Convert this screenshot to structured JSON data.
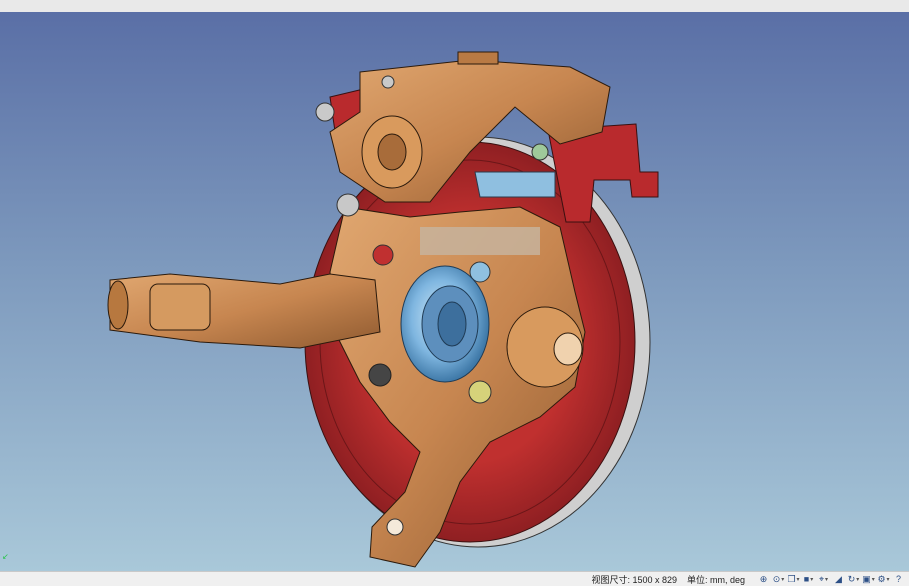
{
  "statusbar": {
    "view_size": "视图尺寸: 1500 x 829",
    "units": "单位: mm, deg",
    "tools": [
      {
        "name": "zoom-fit-icon",
        "glyph": "⊕"
      },
      {
        "name": "zoom-window-icon",
        "glyph": "⊙"
      },
      {
        "name": "view-cube-icon",
        "glyph": "❒"
      },
      {
        "name": "display-mode-icon",
        "glyph": "■"
      },
      {
        "name": "section-icon",
        "glyph": "⌖"
      },
      {
        "name": "measure-icon",
        "glyph": "◢"
      },
      {
        "name": "rotate-icon",
        "glyph": "↻"
      },
      {
        "name": "layout-icon",
        "glyph": "▣"
      },
      {
        "name": "settings-icon",
        "glyph": "⚙"
      },
      {
        "name": "help-icon",
        "glyph": "?"
      }
    ]
  },
  "colors": {
    "viewport_top": "#5a6fa6",
    "viewport_bottom": "#a9c8d9",
    "bronze": "#c98a52",
    "disc_red": "#b3262a",
    "bearing_blue": "#7fb6e0"
  },
  "viewport": {
    "axis_label": "↙"
  }
}
